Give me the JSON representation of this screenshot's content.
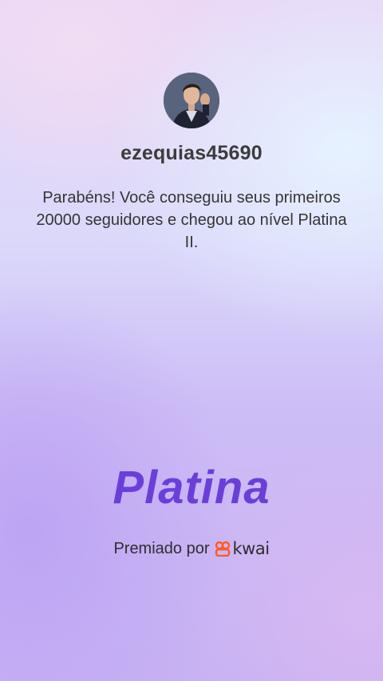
{
  "profile": {
    "username": "ezequias45690",
    "avatar_icon": "user-avatar"
  },
  "message": "Parabéns! Você conseguiu seus primeiros 20000 seguidores e chegou ao nível Platina II.",
  "level": {
    "name": "Platina",
    "color": "#6a3fd9"
  },
  "award": {
    "prefix": "Premiado por",
    "brand": "kwai",
    "brand_icon": "kwai-logo-icon",
    "brand_color": "#ff5a1f"
  }
}
